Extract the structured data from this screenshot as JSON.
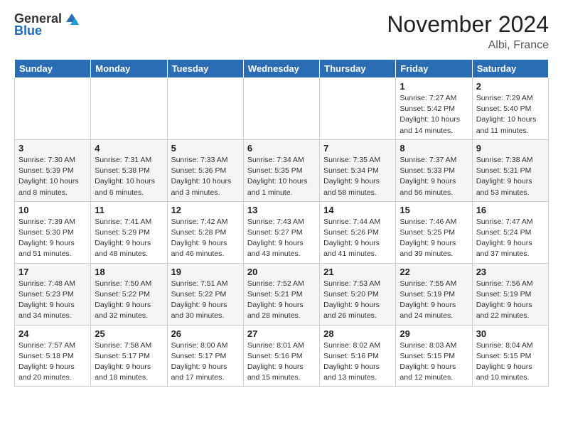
{
  "header": {
    "logo_general": "General",
    "logo_blue": "Blue",
    "month_title": "November 2024",
    "location": "Albi, France"
  },
  "days_of_week": [
    "Sunday",
    "Monday",
    "Tuesday",
    "Wednesday",
    "Thursday",
    "Friday",
    "Saturday"
  ],
  "weeks": [
    [
      {
        "day": "",
        "info": ""
      },
      {
        "day": "",
        "info": ""
      },
      {
        "day": "",
        "info": ""
      },
      {
        "day": "",
        "info": ""
      },
      {
        "day": "",
        "info": ""
      },
      {
        "day": "1",
        "info": "Sunrise: 7:27 AM\nSunset: 5:42 PM\nDaylight: 10 hours and 14 minutes."
      },
      {
        "day": "2",
        "info": "Sunrise: 7:29 AM\nSunset: 5:40 PM\nDaylight: 10 hours and 11 minutes."
      }
    ],
    [
      {
        "day": "3",
        "info": "Sunrise: 7:30 AM\nSunset: 5:39 PM\nDaylight: 10 hours and 8 minutes."
      },
      {
        "day": "4",
        "info": "Sunrise: 7:31 AM\nSunset: 5:38 PM\nDaylight: 10 hours and 6 minutes."
      },
      {
        "day": "5",
        "info": "Sunrise: 7:33 AM\nSunset: 5:36 PM\nDaylight: 10 hours and 3 minutes."
      },
      {
        "day": "6",
        "info": "Sunrise: 7:34 AM\nSunset: 5:35 PM\nDaylight: 10 hours and 1 minute."
      },
      {
        "day": "7",
        "info": "Sunrise: 7:35 AM\nSunset: 5:34 PM\nDaylight: 9 hours and 58 minutes."
      },
      {
        "day": "8",
        "info": "Sunrise: 7:37 AM\nSunset: 5:33 PM\nDaylight: 9 hours and 56 minutes."
      },
      {
        "day": "9",
        "info": "Sunrise: 7:38 AM\nSunset: 5:31 PM\nDaylight: 9 hours and 53 minutes."
      }
    ],
    [
      {
        "day": "10",
        "info": "Sunrise: 7:39 AM\nSunset: 5:30 PM\nDaylight: 9 hours and 51 minutes."
      },
      {
        "day": "11",
        "info": "Sunrise: 7:41 AM\nSunset: 5:29 PM\nDaylight: 9 hours and 48 minutes."
      },
      {
        "day": "12",
        "info": "Sunrise: 7:42 AM\nSunset: 5:28 PM\nDaylight: 9 hours and 46 minutes."
      },
      {
        "day": "13",
        "info": "Sunrise: 7:43 AM\nSunset: 5:27 PM\nDaylight: 9 hours and 43 minutes."
      },
      {
        "day": "14",
        "info": "Sunrise: 7:44 AM\nSunset: 5:26 PM\nDaylight: 9 hours and 41 minutes."
      },
      {
        "day": "15",
        "info": "Sunrise: 7:46 AM\nSunset: 5:25 PM\nDaylight: 9 hours and 39 minutes."
      },
      {
        "day": "16",
        "info": "Sunrise: 7:47 AM\nSunset: 5:24 PM\nDaylight: 9 hours and 37 minutes."
      }
    ],
    [
      {
        "day": "17",
        "info": "Sunrise: 7:48 AM\nSunset: 5:23 PM\nDaylight: 9 hours and 34 minutes."
      },
      {
        "day": "18",
        "info": "Sunrise: 7:50 AM\nSunset: 5:22 PM\nDaylight: 9 hours and 32 minutes."
      },
      {
        "day": "19",
        "info": "Sunrise: 7:51 AM\nSunset: 5:22 PM\nDaylight: 9 hours and 30 minutes."
      },
      {
        "day": "20",
        "info": "Sunrise: 7:52 AM\nSunset: 5:21 PM\nDaylight: 9 hours and 28 minutes."
      },
      {
        "day": "21",
        "info": "Sunrise: 7:53 AM\nSunset: 5:20 PM\nDaylight: 9 hours and 26 minutes."
      },
      {
        "day": "22",
        "info": "Sunrise: 7:55 AM\nSunset: 5:19 PM\nDaylight: 9 hours and 24 minutes."
      },
      {
        "day": "23",
        "info": "Sunrise: 7:56 AM\nSunset: 5:19 PM\nDaylight: 9 hours and 22 minutes."
      }
    ],
    [
      {
        "day": "24",
        "info": "Sunrise: 7:57 AM\nSunset: 5:18 PM\nDaylight: 9 hours and 20 minutes."
      },
      {
        "day": "25",
        "info": "Sunrise: 7:58 AM\nSunset: 5:17 PM\nDaylight: 9 hours and 18 minutes."
      },
      {
        "day": "26",
        "info": "Sunrise: 8:00 AM\nSunset: 5:17 PM\nDaylight: 9 hours and 17 minutes."
      },
      {
        "day": "27",
        "info": "Sunrise: 8:01 AM\nSunset: 5:16 PM\nDaylight: 9 hours and 15 minutes."
      },
      {
        "day": "28",
        "info": "Sunrise: 8:02 AM\nSunset: 5:16 PM\nDaylight: 9 hours and 13 minutes."
      },
      {
        "day": "29",
        "info": "Sunrise: 8:03 AM\nSunset: 5:15 PM\nDaylight: 9 hours and 12 minutes."
      },
      {
        "day": "30",
        "info": "Sunrise: 8:04 AM\nSunset: 5:15 PM\nDaylight: 9 hours and 10 minutes."
      }
    ]
  ]
}
